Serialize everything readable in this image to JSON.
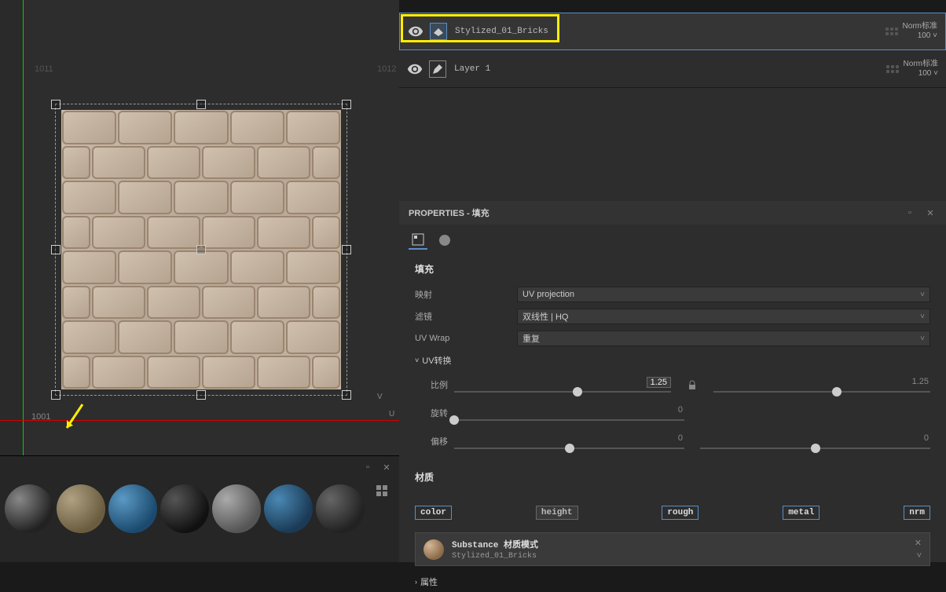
{
  "viewport": {
    "tile_label_bl": "1001",
    "tile_label_tl": "1011",
    "tile_label_tr": "1012",
    "axis_v": "V",
    "axis_u": "U"
  },
  "layers": {
    "items": [
      {
        "name": "Stylized_01_Bricks",
        "mode": "Norm标准",
        "opacity": "100"
      },
      {
        "name": "Layer 1",
        "mode": "Norm标准",
        "opacity": "100"
      }
    ]
  },
  "properties": {
    "title": "PROPERTIES - 填充",
    "section_fill": "填充",
    "projection_label": "映射",
    "projection_value": "UV projection",
    "filter_label": "滤镜",
    "filter_value": "双线性 | HQ",
    "wrap_label": "UV Wrap",
    "wrap_value": "重复",
    "uv_transform": "UV转换",
    "scale_label": "比例",
    "scale_value_l": "1.25",
    "scale_value_r": "1.25",
    "rotation_label": "旋转",
    "rotation_value": "0",
    "offset_label": "偏移",
    "offset_value_l": "0",
    "offset_value_r": "0",
    "section_material": "材质",
    "channels": {
      "color": "color",
      "height": "height",
      "rough": "rough",
      "metal": "metal",
      "nrm": "nrm"
    },
    "material": {
      "title": "Substance 材质模式",
      "name": "Stylized_01_Bricks"
    },
    "attributes": "属性"
  }
}
